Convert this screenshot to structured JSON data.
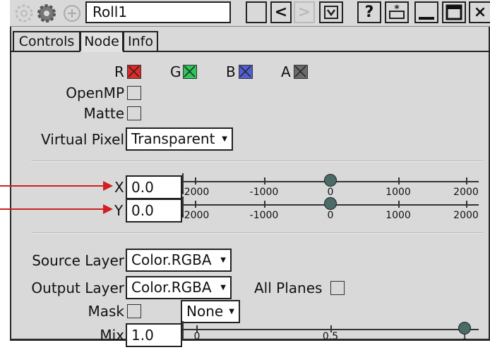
{
  "titlebar": {
    "node_name": "Roll1",
    "help_label": "?",
    "prev_label": "<",
    "next_label": ">",
    "close_label": "×"
  },
  "tabs": [
    {
      "label": "Controls",
      "selected": false
    },
    {
      "label": "Node",
      "selected": true
    },
    {
      "label": "Info",
      "selected": false
    }
  ],
  "channels": [
    {
      "label": "R",
      "color": "#e02a2a"
    },
    {
      "label": "G",
      "color": "#2ec65a"
    },
    {
      "label": "B",
      "color": "#5060d0"
    },
    {
      "label": "A",
      "color": "#6b6b6b"
    }
  ],
  "openmp_label": "OpenMP",
  "matte_label": "Matte",
  "virtual_pixel": {
    "label": "Virtual Pixel",
    "value": "Transparent"
  },
  "x_param": {
    "label": "X",
    "value": "0.0",
    "ticks": [
      "-2000",
      "-1000",
      "0",
      "1000",
      "2000"
    ],
    "slider_value": 0
  },
  "y_param": {
    "label": "Y",
    "value": "0.0",
    "ticks": [
      "-2000",
      "-1000",
      "0",
      "1000",
      "2000"
    ],
    "slider_value": 0
  },
  "source_layer": {
    "label": "Source Layer",
    "value": "Color.RGBA"
  },
  "output_layer": {
    "label": "Output Layer",
    "value": "Color.RGBA"
  },
  "all_planes_label": "All Planes",
  "mask": {
    "label": "Mask",
    "value": "None"
  },
  "mix": {
    "label": "Mix",
    "value": "1.0",
    "ticks": [
      "0",
      "0.5",
      "1"
    ],
    "slider_value": 1.0
  }
}
